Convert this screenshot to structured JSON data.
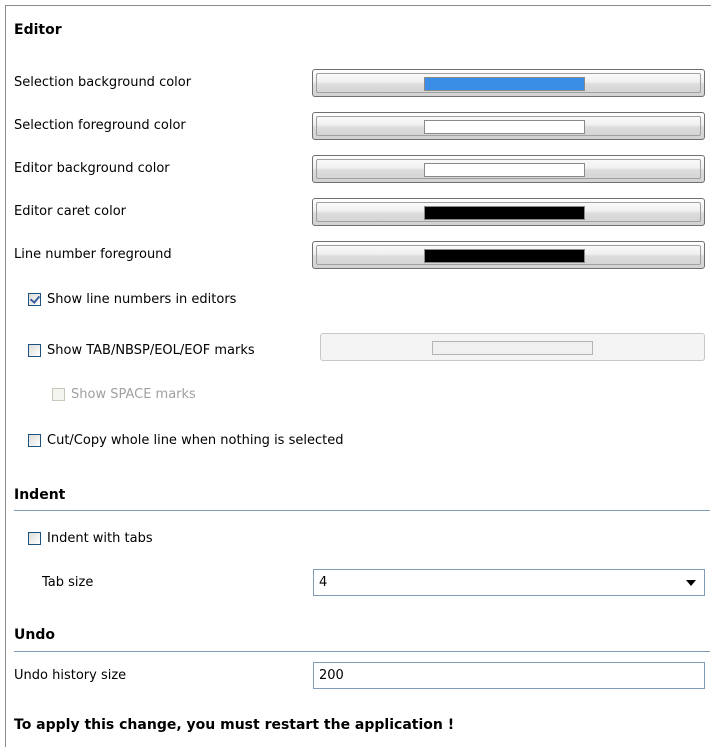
{
  "editor": {
    "title": "Editor",
    "colors": [
      {
        "label": "Selection background color",
        "swatch": "#3a8ee6"
      },
      {
        "label": "Selection foreground color",
        "swatch": "#ffffff"
      },
      {
        "label": "Editor background color",
        "swatch": "#ffffff"
      },
      {
        "label": "Editor caret color",
        "swatch": "#000000"
      },
      {
        "label": "Line number foreground",
        "swatch": "#000000"
      }
    ],
    "show_line_numbers": {
      "label": "Show line numbers in editors",
      "checked": true
    },
    "show_marks": {
      "label": "Show TAB/NBSP/EOL/EOF marks",
      "checked": false
    },
    "show_space_marks": {
      "label": "Show SPACE marks",
      "checked": false,
      "enabled": false
    },
    "cut_copy_line": {
      "label": "Cut/Copy whole line when nothing is selected",
      "checked": false
    }
  },
  "indent": {
    "title": "Indent",
    "indent_with_tabs": {
      "label": "Indent with tabs",
      "checked": false
    },
    "tab_size_label": "Tab size",
    "tab_size_value": "4"
  },
  "undo": {
    "title": "Undo",
    "history_label": "Undo history size",
    "history_value": "200"
  },
  "footer": {
    "restart_notice": "To apply this change, you must restart the application !"
  }
}
